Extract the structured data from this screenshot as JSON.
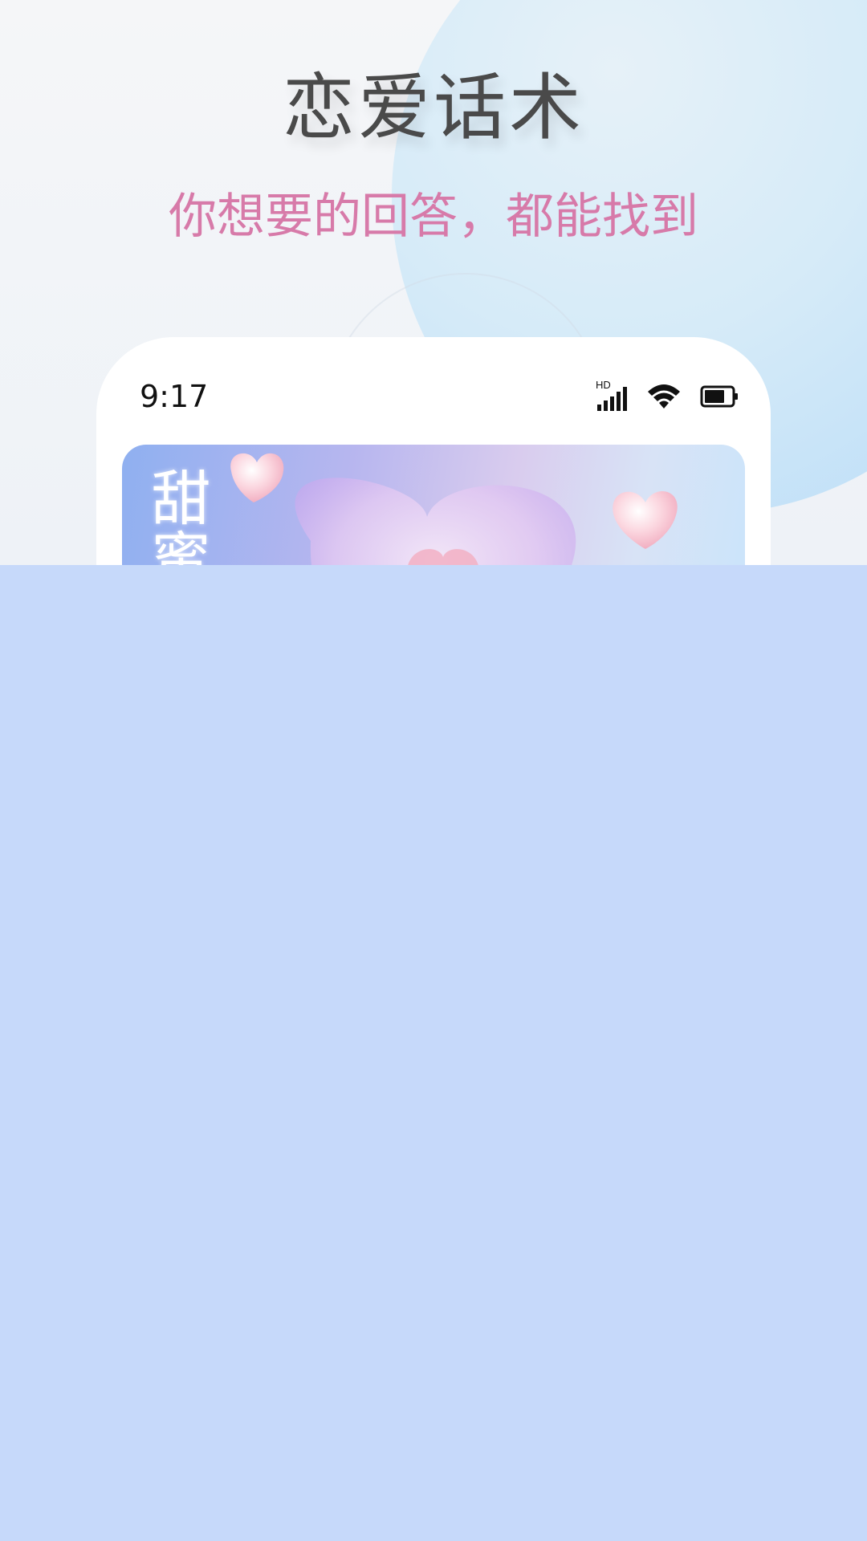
{
  "header": {
    "title": "恋爱话术",
    "subtitle": "你想要的回答，都能找到"
  },
  "phone": {
    "status_bar": {
      "time": "9:17",
      "network_label": "HD",
      "icons": [
        "signal-icon",
        "wifi-icon",
        "battery-icon"
      ]
    },
    "banner": {
      "text": "甜蜜",
      "icons": [
        "heart-icon",
        "heart-icon",
        "heart-icon"
      ]
    }
  },
  "colors": {
    "title": "#4a4a4a",
    "subtitle": "#d77aa9",
    "bottom_background": "#c6d9fa",
    "phone_background": "#ffffff"
  }
}
